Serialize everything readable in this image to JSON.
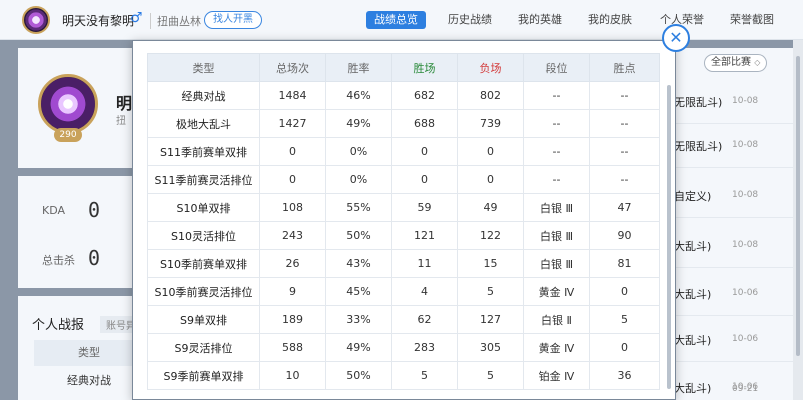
{
  "header": {
    "player_name": "明天没有黎明",
    "region": "扭曲丛林",
    "find_button": "找人开黑",
    "tabs": [
      {
        "label": "战绩总览",
        "active": true
      },
      {
        "label": "历史战绩",
        "active": false
      },
      {
        "label": "我的英雄",
        "active": false
      },
      {
        "label": "我的皮肤",
        "active": false
      },
      {
        "label": "个人荣誉",
        "active": false
      },
      {
        "label": "荣誉截图",
        "active": false
      }
    ]
  },
  "profile": {
    "level": "290",
    "name_peek": "明",
    "sub_peek": "扭"
  },
  "stats": {
    "kda_label": "KDA",
    "kda_value": "0",
    "kills_label": "总击杀",
    "kills_value": "0"
  },
  "report": {
    "title": "个人战报",
    "tag": "账号异",
    "header": "类型",
    "row1": "经典对战"
  },
  "matches": {
    "filter_button": "全部比赛",
    "rows": [
      {
        "mode": "无限乱斗)",
        "date": "10-08"
      },
      {
        "mode": "无限乱斗)",
        "date": "10-08"
      },
      {
        "mode": "自定义)",
        "date": "10-08"
      },
      {
        "mode": "大乱斗)",
        "date": "10-08"
      },
      {
        "mode": "大乱斗)",
        "date": "10-06"
      },
      {
        "mode": "大乱斗)",
        "date": "10-06"
      },
      {
        "mode": "大乱斗)",
        "date": "10-06"
      },
      {
        "mode": "",
        "date": "09-21"
      }
    ]
  },
  "stats_table": {
    "headers": [
      "类型",
      "总场次",
      "胜率",
      "胜场",
      "负场",
      "段位",
      "胜点"
    ],
    "rows": [
      [
        "经典对战",
        "1484",
        "46%",
        "682",
        "802",
        "--",
        "--"
      ],
      [
        "极地大乱斗",
        "1427",
        "49%",
        "688",
        "739",
        "--",
        "--"
      ],
      [
        "S11季前赛单双排",
        "0",
        "0%",
        "0",
        "0",
        "--",
        "--"
      ],
      [
        "S11季前赛灵活排位",
        "0",
        "0%",
        "0",
        "0",
        "--",
        "--"
      ],
      [
        "S10单双排",
        "108",
        "55%",
        "59",
        "49",
        "白银 Ⅲ",
        "47"
      ],
      [
        "S10灵活排位",
        "243",
        "50%",
        "121",
        "122",
        "白银 Ⅲ",
        "90"
      ],
      [
        "S10季前赛单双排",
        "26",
        "43%",
        "11",
        "15",
        "白银 Ⅲ",
        "81"
      ],
      [
        "S10季前赛灵活排位",
        "9",
        "45%",
        "4",
        "5",
        "黄金 Ⅳ",
        "0"
      ],
      [
        "S9单双排",
        "189",
        "33%",
        "62",
        "127",
        "白银 Ⅱ",
        "5"
      ],
      [
        "S9灵活排位",
        "588",
        "49%",
        "283",
        "305",
        "黄金 Ⅳ",
        "0"
      ],
      [
        "S9季前赛单双排",
        "10",
        "50%",
        "5",
        "5",
        "铂金 Ⅳ",
        "36"
      ]
    ]
  },
  "icons": {
    "gender": "♂",
    "close": "✕",
    "chevron": "⌃"
  }
}
